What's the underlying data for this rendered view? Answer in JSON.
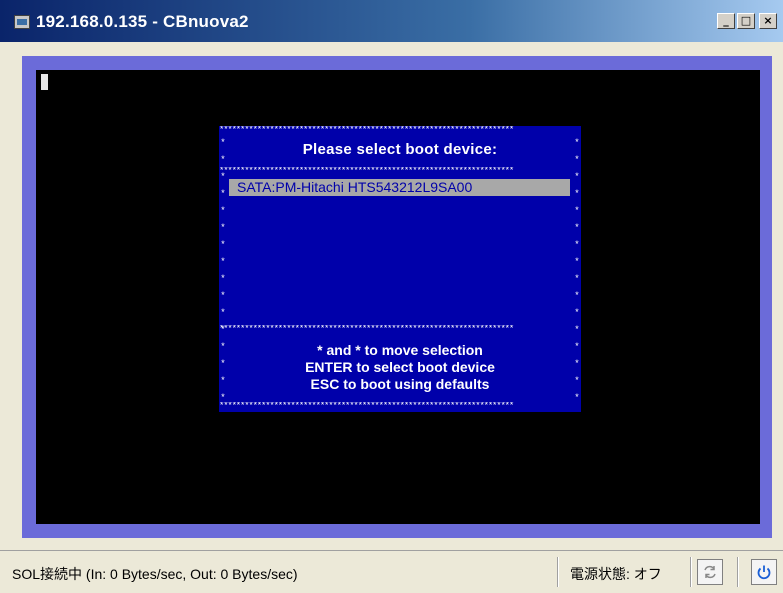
{
  "window": {
    "title": "192.168.0.135 - CBnuova2",
    "minimize_label": "_",
    "maximize_label": "□",
    "close_label": "×"
  },
  "console": {
    "dialog": {
      "title": "Please select boot device:",
      "devices": [
        "SATA:PM-Hitachi HTS543212L9SA00"
      ],
      "selected_index": 0,
      "help": [
        "* and * to move selection",
        "ENTER to select boot device",
        "ESC to boot using defaults"
      ],
      "border_char": "*"
    }
  },
  "statusbar": {
    "connection_text": "SOL接続中 (In: 0 Bytes/sec, Out: 0 Bytes/sec)",
    "power_state": "電源状態: オフ",
    "refresh_icon": "refresh-icon",
    "power_icon": "power-icon"
  },
  "colors": {
    "title_bar": "#0a246a",
    "frame": "#6b6bd9",
    "dialog_bg": "#0000aa",
    "selection_bg": "#a8a8a8",
    "power_icon": "#1a5fd6"
  }
}
